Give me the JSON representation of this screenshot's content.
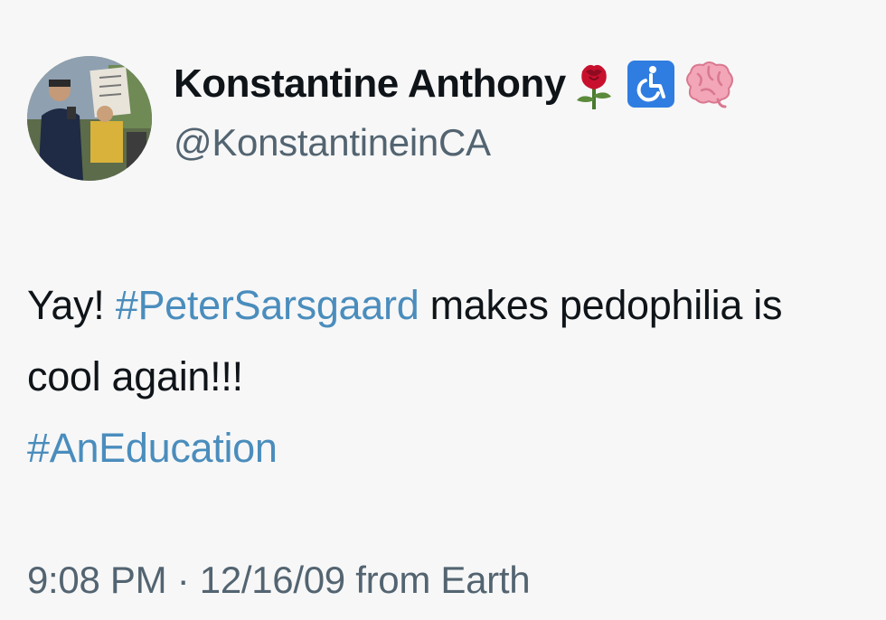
{
  "user": {
    "display_name": "Konstantine Anthony",
    "handle": "@KonstantineinCA",
    "badges": [
      "rose-icon",
      "wheelchair-icon",
      "brain-icon"
    ]
  },
  "tweet": {
    "text_1": "Yay! ",
    "hashtag_1": "#PeterSarsgaard",
    "text_2": " makes pedophilia is cool again!!!",
    "hashtag_2": "#AnEducation"
  },
  "meta": {
    "time": "9:08 PM",
    "separator": " · ",
    "date": "12/16/09",
    "source": " from Earth"
  },
  "colors": {
    "hashtag": "#4a8dbd",
    "secondary_text": "#536471",
    "primary_text": "#0f1419",
    "accessibility_blue": "#2f7de1"
  }
}
